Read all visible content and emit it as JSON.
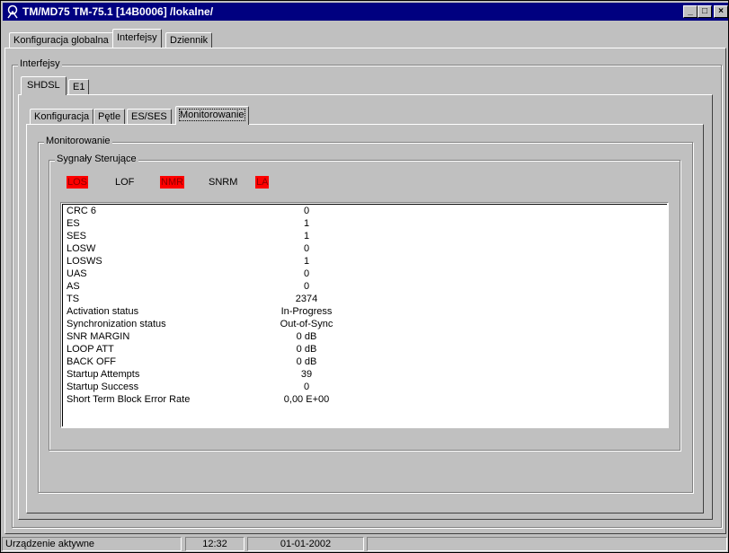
{
  "window": {
    "title": "TM/MD75 TM-75.1 [14B0006] /lokalne/",
    "controls": {
      "minimize": "_",
      "maximize": "□",
      "close": "×"
    }
  },
  "main_tabs": [
    {
      "label": "Konfiguracja globalna",
      "active": false
    },
    {
      "label": "Interfejsy",
      "active": true
    },
    {
      "label": "Dziennik",
      "active": false
    }
  ],
  "interfejsy": {
    "group_label": "Interfejsy",
    "tabs": [
      {
        "label": "SHDSL",
        "active": true
      },
      {
        "label": "E1",
        "active": false
      }
    ],
    "shdsl_tabs": [
      {
        "label": "Konfiguracja",
        "active": false
      },
      {
        "label": "Pętle",
        "active": false
      },
      {
        "label": "ES/SES",
        "active": false
      },
      {
        "label": "Monitorowanie",
        "active": true
      }
    ]
  },
  "monitorowanie": {
    "group_label": "Monitorowanie",
    "signals_group_label": "Sygnały Sterujące",
    "signals": [
      {
        "label": "LOS",
        "active": true,
        "color": "#ff0000"
      },
      {
        "label": "LOF",
        "active": false
      },
      {
        "label": "NMR",
        "active": true,
        "color": "#ff0000"
      },
      {
        "label": "SNRM",
        "active": false
      },
      {
        "label": "LA",
        "active": true,
        "color": "#ff0000"
      }
    ],
    "rows": [
      {
        "name": "CRC 6",
        "value": "0"
      },
      {
        "name": "ES",
        "value": "1"
      },
      {
        "name": "SES",
        "value": "1"
      },
      {
        "name": "LOSW",
        "value": "0"
      },
      {
        "name": "LOSWS",
        "value": "1"
      },
      {
        "name": "UAS",
        "value": "0"
      },
      {
        "name": "AS",
        "value": "0"
      },
      {
        "name": "TS",
        "value": "2374"
      },
      {
        "name": "Activation status",
        "value": "In-Progress"
      },
      {
        "name": "Synchronization status",
        "value": "Out-of-Sync"
      },
      {
        "name": "SNR MARGIN",
        "value": "0 dB"
      },
      {
        "name": "LOOP ATT",
        "value": "0 dB"
      },
      {
        "name": "BACK OFF",
        "value": "0 dB"
      },
      {
        "name": "Startup Attempts",
        "value": "39"
      },
      {
        "name": "Startup Success",
        "value": "0"
      },
      {
        "name": "Short Term Block Error Rate",
        "value": "0,00 E+00"
      }
    ]
  },
  "statusbar": {
    "status": "Urządzenie aktywne",
    "time": "12:32",
    "date": "01-01-2002"
  }
}
